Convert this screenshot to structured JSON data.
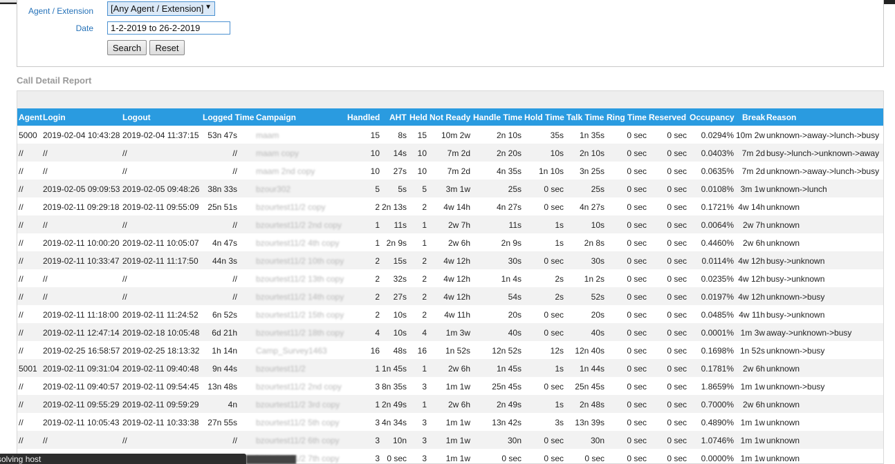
{
  "filters": {
    "agent_label": "Agent / Extension",
    "agent_value": "[Any Agent / Extension]",
    "date_label": "Date",
    "date_value": "1-2-2019 to 26-2-2019",
    "search_label": "Search",
    "reset_label": "Reset"
  },
  "report": {
    "title": "Call Detail Report",
    "columns": [
      "Agent",
      "Login",
      "Logout",
      "Logged Time",
      "Campaign",
      "Handled",
      "AHT",
      "Held",
      "Not Ready",
      "Handle Time",
      "Hold Time",
      "Talk Time",
      "Ring Time",
      "Reserved",
      "Occupancy",
      "Break",
      "Reason"
    ],
    "rows": [
      [
        "5000",
        "2019-02-04 10:43:28",
        "2019-02-04 11:37:15",
        "53n 47s",
        "maam",
        "15",
        "8s",
        "15",
        "10m 2w",
        "2n 10s",
        "35s",
        "1n 35s",
        "0 sec",
        "0 sec",
        "0.0294%",
        "10m 2w",
        "unknown->away->lunch->busy"
      ],
      [
        "//",
        "//",
        "//",
        "//",
        "maam copy",
        "10",
        "14s",
        "10",
        "7m 2d",
        "2n 20s",
        "10s",
        "2n 10s",
        "0 sec",
        "0 sec",
        "0.0403%",
        "7m 2d",
        "busy->lunch->unknown->away"
      ],
      [
        "//",
        "//",
        "//",
        "//",
        "maam 2nd copy",
        "10",
        "27s",
        "10",
        "7m 2d",
        "4n 35s",
        "1n 10s",
        "3n 25s",
        "0 sec",
        "0 sec",
        "0.0635%",
        "7m 2d",
        "unknown->away->lunch->busy"
      ],
      [
        "//",
        "2019-02-05 09:09:53",
        "2019-02-05 09:48:26",
        "38n 33s",
        "bzour302",
        "5",
        "5s",
        "5",
        "3m 1w",
        "25s",
        "0 sec",
        "25s",
        "0 sec",
        "0 sec",
        "0.0108%",
        "3m 1w",
        "unknown->lunch"
      ],
      [
        "//",
        "2019-02-11 09:29:18",
        "2019-02-11 09:55:09",
        "25n 51s",
        "bzourtest11/2 copy",
        "2",
        "2n 13s",
        "2",
        "4w 14h",
        "4n 27s",
        "0 sec",
        "4n 27s",
        "0 sec",
        "0 sec",
        "0.1721%",
        "4w 14h",
        "unknown"
      ],
      [
        "//",
        "//",
        "//",
        "//",
        "bzourtest11/2 2nd copy",
        "1",
        "11s",
        "1",
        "2w 7h",
        "11s",
        "1s",
        "10s",
        "0 sec",
        "0 sec",
        "0.0064%",
        "2w 7h",
        "unknown"
      ],
      [
        "//",
        "2019-02-11 10:00:20",
        "2019-02-11 10:05:07",
        "4n 47s",
        "bzourtest11/2 4th copy",
        "1",
        "2n 9s",
        "1",
        "2w 6h",
        "2n 9s",
        "1s",
        "2n 8s",
        "0 sec",
        "0 sec",
        "0.4460%",
        "2w 6h",
        "unknown"
      ],
      [
        "//",
        "2019-02-11 10:33:47",
        "2019-02-11 11:17:50",
        "44n 3s",
        "bzourtest11/2 10th copy",
        "2",
        "15s",
        "2",
        "4w 12h",
        "30s",
        "0 sec",
        "30s",
        "0 sec",
        "0 sec",
        "0.0114%",
        "4w 12h",
        "busy->unknown"
      ],
      [
        "//",
        "//",
        "//",
        "//",
        "bzourtest11/2 13th copy",
        "2",
        "32s",
        "2",
        "4w 12h",
        "1n 4s",
        "2s",
        "1n 2s",
        "0 sec",
        "0 sec",
        "0.0235%",
        "4w 12h",
        "busy->unknown"
      ],
      [
        "//",
        "//",
        "//",
        "//",
        "bzourtest11/2 14th copy",
        "2",
        "27s",
        "2",
        "4w 12h",
        "54s",
        "2s",
        "52s",
        "0 sec",
        "0 sec",
        "0.0197%",
        "4w 12h",
        "unknown->busy"
      ],
      [
        "//",
        "2019-02-11 11:18:00",
        "2019-02-11 11:24:52",
        "6n 52s",
        "bzourtest11/2 15th copy",
        "2",
        "10s",
        "2",
        "4w 11h",
        "20s",
        "0 sec",
        "20s",
        "0 sec",
        "0 sec",
        "0.0485%",
        "4w 11h",
        "busy->unknown"
      ],
      [
        "//",
        "2019-02-11 12:47:14",
        "2019-02-18 10:05:48",
        "6d 21h",
        "bzourtest11/2 18th copy",
        "4",
        "10s",
        "4",
        "1m 3w",
        "40s",
        "0 sec",
        "40s",
        "0 sec",
        "0 sec",
        "0.0001%",
        "1m 3w",
        "away->unknown->busy"
      ],
      [
        "//",
        "2019-02-25 16:58:57",
        "2019-02-25 18:13:32",
        "1h 14n",
        "Camp_Survey1463",
        "16",
        "48s",
        "16",
        "1n 52s",
        "12n 52s",
        "12s",
        "12n 40s",
        "0 sec",
        "0 sec",
        "0.1698%",
        "1n 52s",
        "unknown->busy"
      ],
      [
        "5001",
        "2019-02-11 09:31:04",
        "2019-02-11 09:40:48",
        "9n 44s",
        "bzourtest11/2",
        "1",
        "1n 45s",
        "1",
        "2w 6h",
        "1n 45s",
        "1s",
        "1n 44s",
        "0 sec",
        "0 sec",
        "0.1781%",
        "2w 6h",
        "unknown"
      ],
      [
        "//",
        "2019-02-11 09:40:57",
        "2019-02-11 09:54:45",
        "13n 48s",
        "bzourtest11/2 2nd copy",
        "3",
        "8n 35s",
        "3",
        "1m 1w",
        "25n 45s",
        "0 sec",
        "25n 45s",
        "0 sec",
        "0 sec",
        "1.8659%",
        "1m 1w",
        "unknown->busy"
      ],
      [
        "//",
        "2019-02-11 09:55:29",
        "2019-02-11 09:59:29",
        "4n",
        "bzourtest11/2 3rd copy",
        "1",
        "2n 49s",
        "1",
        "2w 6h",
        "2n 49s",
        "1s",
        "2n 48s",
        "0 sec",
        "0 sec",
        "0.7000%",
        "2w 6h",
        "unknown"
      ],
      [
        "//",
        "2019-02-11 10:05:43",
        "2019-02-11 10:33:38",
        "27n 55s",
        "bzourtest11/2 5th copy",
        "3",
        "4n 34s",
        "3",
        "1m 1w",
        "13n 42s",
        "3s",
        "13n 39s",
        "0 sec",
        "0 sec",
        "0.4890%",
        "1m 1w",
        "unknown"
      ],
      [
        "//",
        "//",
        "//",
        "//",
        "bzourtest11/2 6th copy",
        "3",
        "10n",
        "3",
        "1m 1w",
        "30n",
        "0 sec",
        "30n",
        "0 sec",
        "0 sec",
        "1.0746%",
        "1m 1w",
        "unknown"
      ],
      [
        "",
        "",
        "",
        "",
        "bzourtest11/2 7th copy",
        "3",
        "0 sec",
        "3",
        "1m 1w",
        "0 sec",
        "0 sec",
        "0 sec",
        "0 sec",
        "0 sec",
        "0.0000%",
        "1m 1w",
        "unknown"
      ]
    ]
  },
  "statusbar": {
    "text": "solving host"
  }
}
